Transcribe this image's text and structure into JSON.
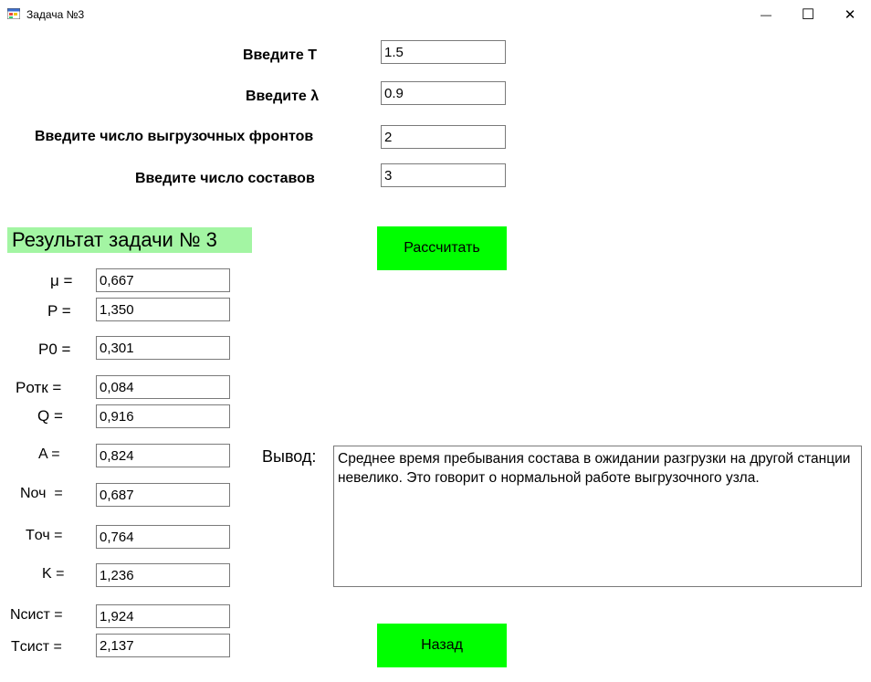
{
  "window": {
    "title": "Задача №3",
    "minimize_glyph": "—",
    "maximize_glyph": "☐",
    "close_glyph": "✕"
  },
  "inputs": {
    "t": {
      "label": "Введите T",
      "value": "1.5"
    },
    "lambda": {
      "label": "Введите λ",
      "value": "0.9"
    },
    "fronts": {
      "label": "Введите число выгрузочных фронтов",
      "value": "2"
    },
    "trains": {
      "label": "Введите число составов",
      "value": "3"
    }
  },
  "buttons": {
    "calculate": "Рассчитать",
    "back": "Назад"
  },
  "results": {
    "header": "Результат задачи № 3",
    "mu": {
      "label": "μ =",
      "value": "0,667"
    },
    "p": {
      "label": "P =",
      "value": "1,350"
    },
    "p0": {
      "label": "P0 =",
      "value": "0,301"
    },
    "potk": {
      "label": "Pотк =",
      "value": "0,084"
    },
    "q": {
      "label": "Q =",
      "value": "0,916"
    },
    "a": {
      "label": "A =",
      "value": "0,824"
    },
    "noch": {
      "label": "Nоч  =",
      "value": "0,687"
    },
    "toch": {
      "label": "Tоч =",
      "value": "0,764"
    },
    "k": {
      "label": "K =",
      "value": "1,236"
    },
    "nsist": {
      "label": "Nсист =",
      "value": "1,924"
    },
    "tsist": {
      "label": "Tсист =",
      "value": "2,137"
    }
  },
  "output": {
    "label": "Вывод:",
    "text": "Среднее время пребывания состава в ожидании разгрузки на другой станции невелико. Это говорит о нормальной работе выгрузочного узла."
  }
}
